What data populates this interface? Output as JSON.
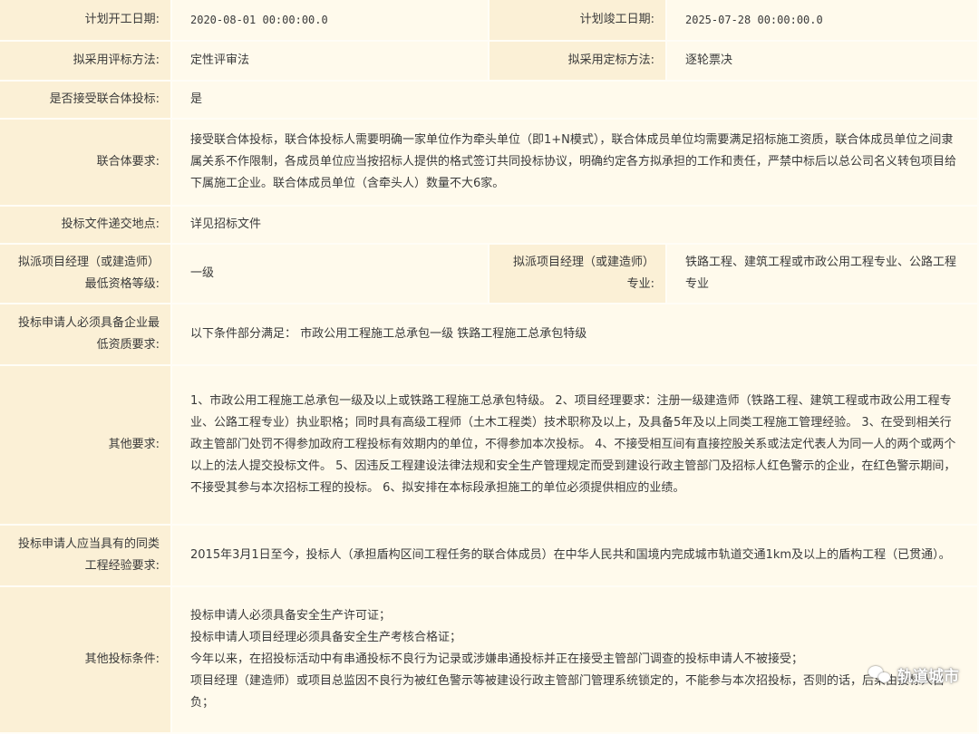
{
  "rows": {
    "start_date": {
      "label": "计划开工日期:",
      "value": "2020-08-01 00:00:00.0"
    },
    "end_date": {
      "label": "计划竣工日期:",
      "value": "2025-07-28 00:00:00.0"
    },
    "eval_method": {
      "label": "拟采用评标方法:",
      "value": "定性评审法"
    },
    "award_method": {
      "label": "拟采用定标方法:",
      "value": "逐轮票决"
    },
    "consortium_accept": {
      "label": "是否接受联合体投标:",
      "value": "是"
    },
    "consortium_req": {
      "label": "联合体要求:",
      "value": "接受联合体投标，联合体投标人需要明确一家单位作为牵头单位（即1+N模式），联合体成员单位均需要满足招标施工资质，联合体成员单位之间隶属关系不作限制，各成员单位应当按招标人提供的格式签订共同投标协议，明确约定各方拟承担的工作和责任，严禁中标后以总公司名义转包项目给下属施工企业。联合体成员单位（含牵头人）数量不大6家。"
    },
    "submit_location": {
      "label": "投标文件递交地点:",
      "value": "详见招标文件"
    },
    "pm_level": {
      "label_1": "拟派项目经理（或建造师）",
      "label_2": "最低资格等级:",
      "value": "一级"
    },
    "pm_major": {
      "label_1": "拟派项目经理（或建造师）",
      "label_2": "专业:",
      "value": "铁路工程、建筑工程或市政公用工程专业、公路工程专业"
    },
    "qualification": {
      "label_1": "投标申请人必须具备企业最",
      "label_2": "低资质要求:",
      "value": "以下条件部分满足： 市政公用工程施工总承包一级 铁路工程施工总承包特级"
    },
    "other_req": {
      "label": "其他要求:",
      "value": "1、市政公用工程施工总承包一级及以上或铁路工程施工总承包特级。 2、项目经理要求：注册一级建造师（铁路工程、建筑工程或市政公用工程专业、公路工程专业）执业职格；同时具有高级工程师（土木工程类）技术职称及以上，及具备5年及以上同类工程施工管理经验。 3、在受到相关行政主管部门处罚不得参加政府工程投标有效期内的单位，不得参加本次投标。 4、不接受相互间有直接控股关系或法定代表人为同一人的两个或两个以上的法人提交投标文件。 5、因违反工程建设法律法规和安全生产管理规定而受到建设行政主管部门及招标人红色警示的企业，在红色警示期间，不接受其参与本次招标工程的投标。 6、拟安排在本标段承担施工的单位必须提供相应的业绩。"
    },
    "experience": {
      "label_1": "投标申请人应当具有的同类",
      "label_2": "工程经验要求:",
      "value": "2015年3月1日至今，投标人（承担盾构区间工程任务的联合体成员）在中华人民共和国境内完成城市轨道交通1km及以上的盾构工程（已贯通）。"
    },
    "other_conditions": {
      "label": "其他投标条件:",
      "lines": [
        "投标申请人必须具备安全生产许可证；",
        "投标申请人项目经理必须具备安全生产考核合格证；",
        "今年以来，在招投标活动中有串通投标不良行为记录或涉嫌串通投标并正在接受主管部门调查的投标申请人不被接受；",
        "项目经理（建造师）或项目总监因不良行为被红色警示等被建设行政主管部门管理系统锁定的，不能参与本次招投标，否则的话，后果由投标人自负；"
      ]
    }
  },
  "watermark": {
    "text": "轨道城市",
    "icon": "wechat-icon"
  }
}
